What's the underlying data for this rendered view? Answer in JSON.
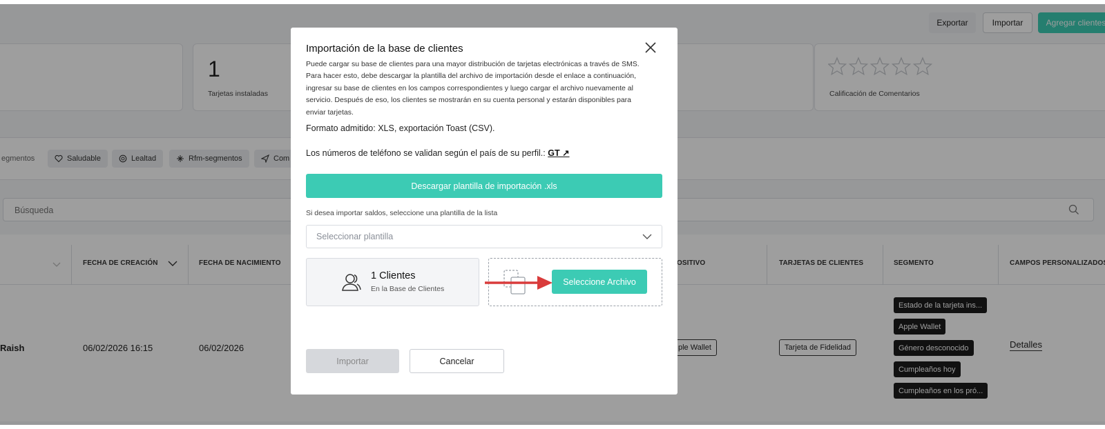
{
  "toolbar": {
    "export_label": "Exportar",
    "import_label": "Importar",
    "add_label": "Agregar clientes"
  },
  "stats": {
    "installed_value": "1",
    "installed_label": "Tarjetas instaladas",
    "rating_label": "Calificación de Comentarios",
    "rating_stars": 0
  },
  "segments": [
    "egmentos",
    "Saludable",
    "Lealtad",
    "Rfm-segmentos",
    "Com"
  ],
  "search": {
    "placeholder": "Búsqueda"
  },
  "table": {
    "headers": {
      "creation": "FECHA DE CREACIÓN",
      "birth": "FECHA DE NACIMIENTO",
      "device": "OSITIVO",
      "cards": "TARJETAS DE CLIENTES",
      "segment": "SEGMENTO",
      "custom": "CAMPOS PERSONALIZADOS"
    },
    "row": {
      "name": "Raish",
      "created": "06/02/2026 16:15",
      "birth": "06/02/2026",
      "device": "ple Wallet",
      "card": "Tarjeta de Fidelidad",
      "segments": [
        "Estado de la tarjeta ins...",
        "Apple Wallet",
        "Género desconocido",
        "Cumpleaños hoy",
        "Cumpleaños en los pró..."
      ],
      "details": "Detalles"
    }
  },
  "modal": {
    "title": "Importación de la base de clientes",
    "description": "Puede cargar su base de clientes para una mayor distribución de tarjetas electrónicas a través de SMS. Para hacer esto, debe descargar la plantilla del archivo de importación desde el enlace a continuación, ingresar su base de clientes en los campos correspondientes y luego cargar el archivo nuevamente al servicio. Después de eso, los clientes se mostrarán en su cuenta personal y estarán disponibles para enviar tarjetas.",
    "format": "Formato admitido: XLS, exportación Toast (CSV).",
    "phone_text": "Los números de teléfono se validan según el país de su perfil.:",
    "phone_link": "GT ↗",
    "download_label": "Descargar plantilla de importación .xls",
    "balance_hint": "Si desea importar saldos, seleccione una plantilla de la lista",
    "template_placeholder": "Seleccionar plantilla",
    "clients_count": "1 Clientes",
    "clients_sub": "En la Base de Clientes",
    "file_button": "Seleccione Archivo",
    "import_label": "Importar",
    "cancel_label": "Cancelar"
  },
  "colors": {
    "accent": "#3ccbb4",
    "arrow": "#d93b3b",
    "tag_dark": "#1c1c1c"
  }
}
